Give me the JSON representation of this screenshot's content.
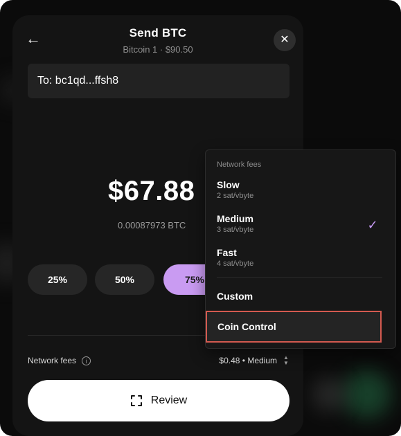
{
  "header": {
    "title": "Send BTC",
    "subtitle": "Bitcoin 1 · $90.50",
    "back_icon": "←",
    "close_icon": "✕"
  },
  "recipient": {
    "value": "To:  bc1qd...ffsh8"
  },
  "amount": {
    "usd": "$67.88",
    "btc": "0.00087973 BTC"
  },
  "presets": [
    "25%",
    "50%",
    "75%"
  ],
  "fees_row": {
    "label": "Network fees",
    "value": "$0.48 • Medium"
  },
  "review_button": {
    "label": "Review"
  },
  "dropdown": {
    "title": "Network fees",
    "options": [
      {
        "name": "Slow",
        "rate": "2 sat/vbyte"
      },
      {
        "name": "Medium",
        "rate": "3 sat/vbyte"
      },
      {
        "name": "Fast",
        "rate": "4 sat/vbyte"
      }
    ],
    "selected": "Medium",
    "custom_label": "Custom",
    "coin_control_label": "Coin Control"
  },
  "icons": {
    "info": "i",
    "check": "✓",
    "up": "▲",
    "down": "▼"
  },
  "colors": {
    "accent": "#c99bf2",
    "highlight_border": "#d45a50",
    "background": "#141414"
  }
}
